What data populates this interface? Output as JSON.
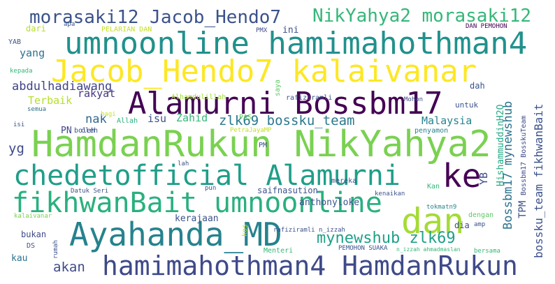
{
  "word_cloud": {
    "words": [
      {
        "text": "morasaki12 Jacob_Hendo7",
        "color": "#3b528b"
      },
      {
        "text": "NikYahya2 morasaki12",
        "color": "#35b779"
      },
      {
        "text": "umnoonline hamimahothman4",
        "color": "#21918c"
      },
      {
        "text": "Jacob_Hendo7 kalaivanar",
        "color": "#fde725"
      },
      {
        "text": "Alamurni Bossbm17",
        "color": "#440154"
      },
      {
        "text": "HamdanRukun NikYahya2",
        "color": "#7ad151"
      },
      {
        "text": "chedetofficial Alamurni",
        "color": "#1f9e89"
      },
      {
        "text": "ke",
        "color": "#440154"
      },
      {
        "text": "fikhwanBait umnoonline",
        "color": "#2ab07f"
      },
      {
        "text": "dan",
        "color": "#a5db36"
      },
      {
        "text": "Ayahanda_MD",
        "color": "#26828e"
      },
      {
        "text": "hamimahothman4 HamdanRukun",
        "color": "#3e4a89"
      },
      {
        "text": "mynewshub zlk69",
        "color": "#1fa088"
      },
      {
        "text": "abdulhadiawang",
        "color": "#414487"
      },
      {
        "text": "zlk69 bossku_team",
        "color": "#2a788e"
      },
      {
        "text": "Bossbm17 mynewshub",
        "color": "#2c728e"
      },
      {
        "text": "bossku_team fikhwanBait",
        "color": "#3b528b"
      },
      {
        "text": "Malaysia",
        "color": "#26828e"
      },
      {
        "text": "akan",
        "color": "#3e4a89"
      },
      {
        "text": "yang",
        "color": "#2c728e"
      },
      {
        "text": "Terbaik",
        "color": "#b5de2b"
      },
      {
        "text": "rakyat",
        "color": "#453781"
      },
      {
        "text": "nak",
        "color": "#31688e"
      },
      {
        "text": "Zahid",
        "color": "#35b779"
      },
      {
        "text": "isu",
        "color": "#3b528b"
      },
      {
        "text": "yg",
        "color": "#3e4a89"
      },
      {
        "text": "PN",
        "color": "#414487"
      },
      {
        "text": "YB",
        "color": "#3e4a89"
      },
      {
        "text": "TPM",
        "color": "#3b528b"
      },
      {
        "text": "HishammuddinH2O",
        "color": "#22a884"
      },
      {
        "text": "Bossbm17 BosskuTeam",
        "color": "#3e4a89"
      },
      {
        "text": "kerajaan",
        "color": "#3b528b"
      },
      {
        "text": "anthonyloke",
        "color": "#39568c"
      },
      {
        "text": "saifnasution",
        "color": "#3b528b"
      },
      {
        "text": "kau",
        "color": "#2c728e"
      },
      {
        "text": "bukan",
        "color": "#3e4a89"
      },
      {
        "text": "dia",
        "color": "#3e4a89"
      },
      {
        "text": "dari",
        "color": "#b5de2b"
      },
      {
        "text": "apa",
        "color": "#3b528b"
      },
      {
        "text": "PELARIAN DAN",
        "color": "#c2df23"
      },
      {
        "text": "PMX",
        "color": "#3e4a89"
      },
      {
        "text": "ini",
        "color": "#3b528b"
      },
      {
        "text": "DAN PEMOHON",
        "color": "#440154"
      },
      {
        "text": "YAB",
        "color": "#3b528b"
      },
      {
        "text": "kepada",
        "color": "#35b779"
      },
      {
        "text": "Alhamdulillah",
        "color": "#a0da39"
      },
      {
        "text": "rafiziramli",
        "color": "#3b528b"
      },
      {
        "text": "Mohon",
        "color": "#3e4a89"
      },
      {
        "text": "dah",
        "color": "#3b528b"
      },
      {
        "text": "untuk",
        "color": "#3b528b"
      },
      {
        "text": "saya",
        "color": "#5ec962"
      },
      {
        "text": "semua",
        "color": "#2c728e"
      },
      {
        "text": "bagi",
        "color": "#c8e020"
      },
      {
        "text": "Allah",
        "color": "#2ab07f"
      },
      {
        "text": "PAS",
        "color": "#5ec962"
      },
      {
        "text": "oleh",
        "color": "#3b528b"
      },
      {
        "text": "isi",
        "color": "#3b528b"
      },
      {
        "text": "boleh",
        "color": "#3b528b"
      },
      {
        "text": "PetraJayaMP",
        "color": "#c2df23"
      },
      {
        "text": "penyamon",
        "color": "#26828e"
      },
      {
        "text": "PM",
        "color": "#3e4a89"
      },
      {
        "text": "lah",
        "color": "#3b528b"
      },
      {
        "text": "mereka",
        "color": "#3b528b"
      },
      {
        "text": "Datuk Seri",
        "color": "#3b528b"
      },
      {
        "text": "pun",
        "color": "#3b528b"
      },
      {
        "text": "kenaikan",
        "color": "#3b528b"
      },
      {
        "text": "Kan",
        "color": "#35b779"
      },
      {
        "text": "tokmatn9",
        "color": "#26828e"
      },
      {
        "text": "dengan",
        "color": "#5ec962"
      },
      {
        "text": "amp",
        "color": "#3b528b"
      },
      {
        "text": "kalaivanar",
        "color": "#7ad151"
      },
      {
        "text": "kos",
        "color": "#b5de2b"
      },
      {
        "text": "rafiziramli n_izzah",
        "color": "#3b528b"
      },
      {
        "text": "DS",
        "color": "#3b528b"
      },
      {
        "text": "rumah",
        "color": "#3b528b"
      },
      {
        "text": "Menteri",
        "color": "#35b779"
      },
      {
        "text": "PEMOHON SUAKA",
        "color": "#3b528b"
      },
      {
        "text": "n_izzah ahmadmaslan",
        "color": "#35b779"
      },
      {
        "text": "bersama",
        "color": "#35b779"
      }
    ]
  }
}
